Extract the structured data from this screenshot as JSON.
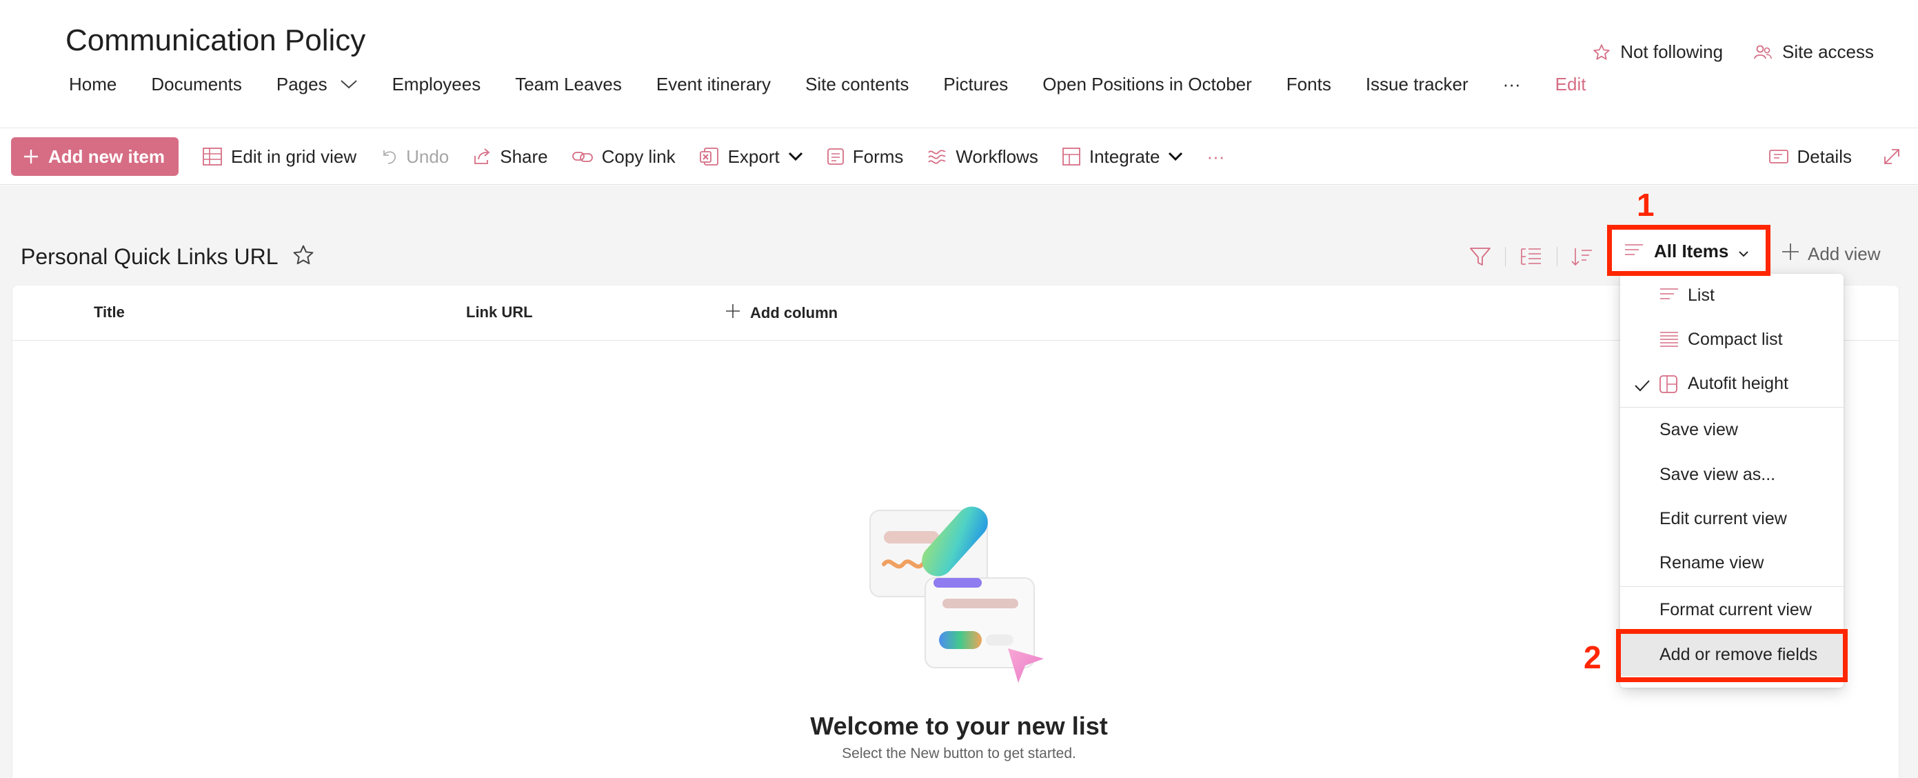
{
  "site": {
    "title": "Communication Policy",
    "nav": [
      "Home",
      "Documents",
      "Pages",
      "Employees",
      "Team Leaves",
      "Event itinerary",
      "Site contents",
      "Pictures",
      "Open Positions in October",
      "Fonts",
      "Issue tracker"
    ],
    "nav_more": "···",
    "nav_edit": "Edit",
    "follow_label": "Not following",
    "access_label": "Site access"
  },
  "toolbar": {
    "add_new_item": "Add new item",
    "edit_grid": "Edit in grid view",
    "undo": "Undo",
    "share": "Share",
    "copy_link": "Copy link",
    "export": "Export",
    "forms": "Forms",
    "workflows": "Workflows",
    "integrate": "Integrate",
    "more": "···",
    "details": "Details"
  },
  "list": {
    "title": "Personal Quick Links URL",
    "columns": [
      "Title",
      "Link URL"
    ],
    "add_column": "Add column",
    "empty_title": "Welcome to your new list",
    "empty_subtitle": "Select the New button to get started."
  },
  "views": {
    "current": "All Items",
    "add_view": "Add view"
  },
  "view_menu": {
    "layouts": [
      "List",
      "Compact list",
      "Autofit height"
    ],
    "checked_layout": "Autofit height",
    "actions": [
      "Save view",
      "Save view as...",
      "Edit current view",
      "Rename view"
    ],
    "format_actions": [
      "Format current view",
      "Add or remove fields"
    ]
  },
  "annotations": {
    "step1": "1",
    "step2": "2"
  },
  "colors": {
    "accent": "#d66d84",
    "callout": "#ff2600",
    "content_bg": "#f4f4f4"
  }
}
